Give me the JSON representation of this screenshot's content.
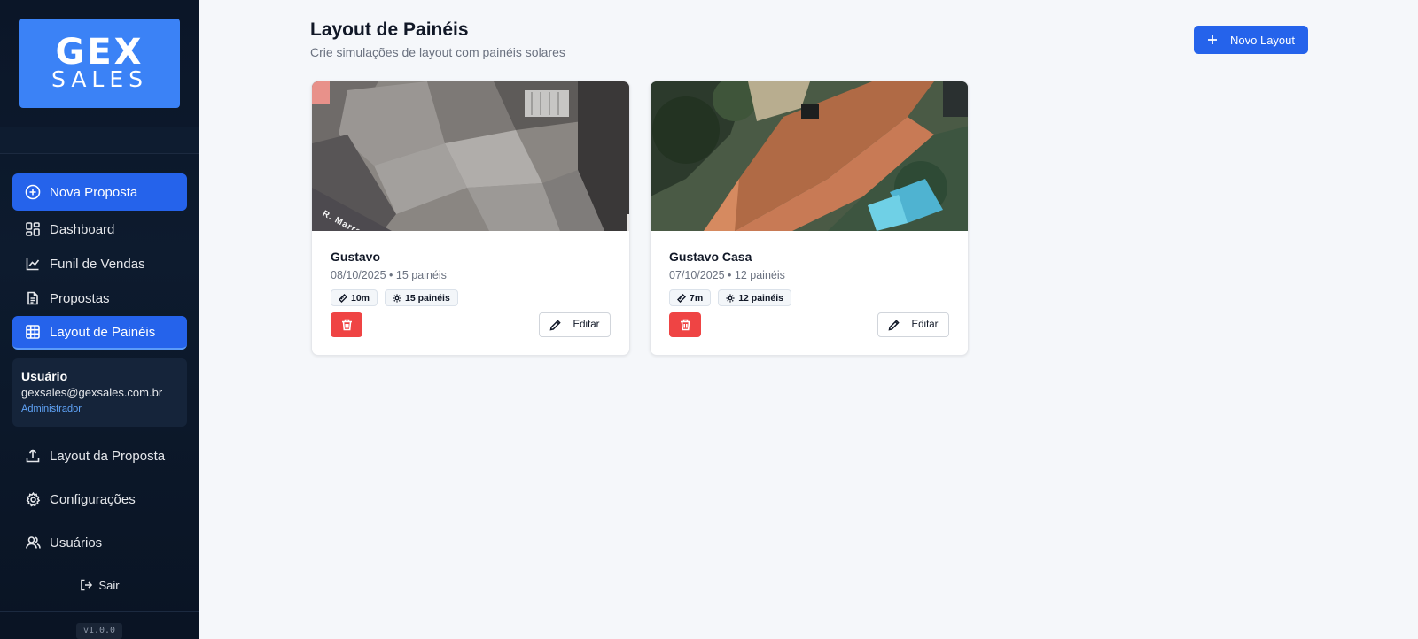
{
  "brand": {
    "logo_top": "GEX",
    "logo_bottom": "SALES"
  },
  "sidebar": {
    "primary_action": {
      "label": "Nova Proposta",
      "icon": "plus-circle-icon"
    },
    "items": [
      {
        "label": "Dashboard",
        "icon": "dashboard-icon"
      },
      {
        "label": "Funil de Vendas",
        "icon": "chart-line-icon"
      },
      {
        "label": "Propostas",
        "icon": "document-icon"
      },
      {
        "label": "Layout de Painéis",
        "icon": "grid-icon",
        "active": true
      }
    ],
    "user": {
      "name": "Usuário",
      "email": "gexsales@gexsales.com.br",
      "role": "Administrador"
    },
    "secondary_items": [
      {
        "label": "Layout da Proposta",
        "icon": "upload-icon"
      },
      {
        "label": "Configurações",
        "icon": "gear-icon"
      },
      {
        "label": "Usuários",
        "icon": "users-icon"
      }
    ],
    "logout_label": "Sair",
    "version": "v1.0.0"
  },
  "header": {
    "title": "Layout de Painéis",
    "subtitle": "Crie simulações de layout com painéis solares",
    "new_button_label": "Novo Layout"
  },
  "cards": [
    {
      "title": "Gustavo",
      "meta": "08/10/2025 • 15 painéis",
      "tag_length": "10m",
      "tag_panels": "15 painéis",
      "image_street_label": "R. Marrey Jr",
      "edit_label": "Editar"
    },
    {
      "title": "Gustavo Casa",
      "meta": "07/10/2025 • 12 painéis",
      "tag_length": "7m",
      "tag_panels": "12 painéis",
      "edit_label": "Editar"
    }
  ],
  "colors": {
    "accent": "#2563eb",
    "sidebar_bg": "#0b1628",
    "danger": "#ef4444",
    "page_bg": "#f5f7fa"
  }
}
